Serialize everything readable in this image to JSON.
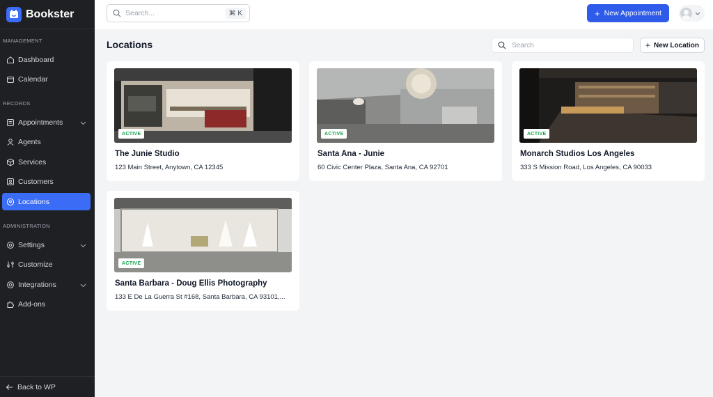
{
  "app": {
    "name": "Bookster"
  },
  "sidebar": {
    "sections": {
      "management": "MANAGEMENT",
      "records": "RECORDS",
      "administration": "ADMINISTRATION"
    },
    "items": [
      {
        "label": "Dashboard",
        "icon": "home-icon"
      },
      {
        "label": "Calendar",
        "icon": "calendar-icon"
      },
      {
        "label": "Appointments",
        "icon": "list-icon"
      },
      {
        "label": "Agents",
        "icon": "user-icon"
      },
      {
        "label": "Services",
        "icon": "box-icon"
      },
      {
        "label": "Customers",
        "icon": "id-card-icon"
      },
      {
        "label": "Locations",
        "icon": "location-pin-icon",
        "active": true
      },
      {
        "label": "Settings",
        "icon": "gear-icon"
      },
      {
        "label": "Customize",
        "icon": "sliders-icon"
      },
      {
        "label": "Integrations",
        "icon": "plug-icon"
      },
      {
        "label": "Add-ons",
        "icon": "puzzle-icon"
      }
    ],
    "back": "Back to WP"
  },
  "topbar": {
    "search_placeholder": "Search...",
    "shortcut": "⌘ K",
    "new_appointment": "New Appointment"
  },
  "main": {
    "title": "Locations",
    "search_placeholder": "Search",
    "new_location": "New Location",
    "locations": [
      {
        "name": "The Junie Studio",
        "address": "123 Main Street, Anytown, CA 12345",
        "status": "ACTIVE"
      },
      {
        "name": "Santa Ana - Junie",
        "address": "60 Civic Center Plaza, Santa Ana, CA 92701",
        "status": "ACTIVE"
      },
      {
        "name": "Monarch Studios Los Angeles",
        "address": "333 S Mission Road, Los Angeles, CA 90033",
        "status": "ACTIVE"
      },
      {
        "name": "Santa Barbara - Doug Ellis Photography",
        "address": "133 E De La Guerra St #168, Santa Barbara, CA 93101,...",
        "status": "ACTIVE"
      }
    ]
  },
  "colors": {
    "accent": "#2f5bea",
    "active_badge": "#16a34a",
    "sidebar_bg": "#1f2023"
  }
}
